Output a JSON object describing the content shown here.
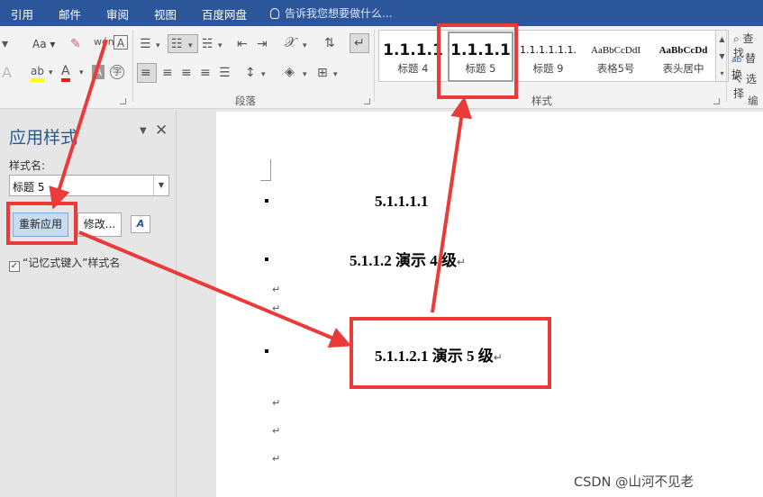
{
  "menubar": {
    "tabs": [
      "引用",
      "邮件",
      "审阅",
      "视图",
      "百度网盘"
    ],
    "tell_me": "告诉我您想要做什么..."
  },
  "ribbon": {
    "paragraph_group": "段落",
    "styles_group": "样式",
    "editing_group": "编辑",
    "font_size_label": "Aa",
    "find_label": "查找",
    "replace_label": "替换",
    "select_label": "选择",
    "styles": [
      {
        "preview": "1.1.1.1",
        "name": "标题 4",
        "selected": false
      },
      {
        "preview": "1.1.1.1",
        "name": "标题 5",
        "selected": true
      },
      {
        "preview": "1.1.1.1.1.1.",
        "name": "标题 9",
        "selected": false
      },
      {
        "preview": "AaBbCcDdI",
        "name": "表格5号",
        "selected": false
      },
      {
        "preview": "AaBbCcDd",
        "name": "表头居中",
        "selected": false
      }
    ]
  },
  "pane": {
    "title": "应用样式",
    "style_name_label": "样式名:",
    "style_name_value": "标题 5",
    "reapply_label": "重新应用",
    "modify_label": "修改...",
    "styles_button_label": "A",
    "autoformat_label": "“记忆式键入”样式名",
    "autoformat_checked": "✓"
  },
  "document": {
    "lines": [
      {
        "text": "5.1.1.1.1",
        "mark": ""
      },
      {
        "text": "5.1.1.2 演示 4 级",
        "mark": "↵"
      },
      {
        "text": "5.1.1.2.1 演示 5 级",
        "mark": "↵"
      }
    ],
    "paragraph_mark": "↵"
  },
  "colors": {
    "title_bar": "#2b579a",
    "annotation": "#ea3a3a",
    "selected_button": "#c8dcf1"
  },
  "watermark": "CSDN @山河不见老"
}
